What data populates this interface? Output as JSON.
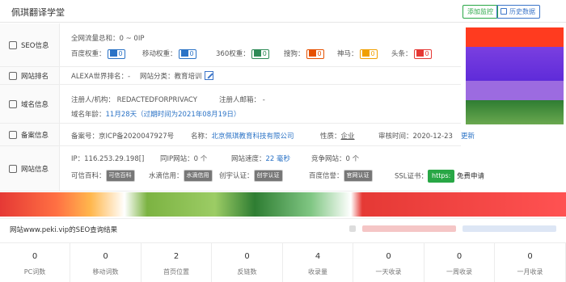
{
  "header": {
    "site_title": "佩琪翻译学堂",
    "add_monitor": "添加监控",
    "history": "历史数据"
  },
  "seo": {
    "label": "SEO信息",
    "traffic": "全网流量总和：0 ~ 0IP",
    "items": [
      {
        "name": "百度权重：",
        "value": "0",
        "color": "#2b73c6"
      },
      {
        "name": "移动权重：",
        "value": "0",
        "color": "#2b73c6"
      },
      {
        "name": "360权重：",
        "value": "0",
        "color": "#2e8b57"
      },
      {
        "name": "搜狗：",
        "value": "0",
        "color": "#e65100"
      },
      {
        "name": "神马：",
        "value": "0",
        "color": "#f0a000"
      },
      {
        "name": "头条：",
        "value": "0",
        "color": "#e53935"
      }
    ]
  },
  "rank": {
    "label": "网站排名",
    "alexa": "ALEXA世界排名：-",
    "category_label": "网站分类：",
    "category": "教育培训"
  },
  "domain": {
    "label": "域名信息",
    "registrant": "注册人/机构： REDACTEDFORPRIVACY",
    "email": "注册人邮箱： -",
    "age_label": "域名年龄：",
    "age": "11月28天（过期时间为2021年08月19日）"
  },
  "icp": {
    "label": "备案信息",
    "record": "备案号：京ICP备2020047927号",
    "name_label": "名称：",
    "name": "北京佩琪教育科技有限公司",
    "nature_label": "性质：",
    "nature": "企业",
    "review_label": "审核时间：",
    "review": "2020-12-23",
    "update": "更新"
  },
  "site": {
    "label": "网站信息",
    "ip": "IP：116.253.29.198[]",
    "same_ip": "同IP网站：0 个",
    "speed_label": "网站速度：",
    "speed": "22 毫秒",
    "competitors": "竞争网站：0 个",
    "credits": [
      {
        "name": "可信百科：",
        "badge": "可信百科"
      },
      {
        "name": "水滴信用：",
        "badge": "水滴信用"
      },
      {
        "name": "创宇认证：",
        "badge": "创宇认证"
      },
      {
        "name": "百度信誉：",
        "badge": "官网认证"
      }
    ],
    "ssl_label": "SSL证书：",
    "ssl_badge": "https:",
    "ssl_apply": "免费申请"
  },
  "seo_query": {
    "title": "网站www.peki.vip的SEO查询结果"
  },
  "stats": [
    {
      "value": "0",
      "label": "PC词数"
    },
    {
      "value": "0",
      "label": "移动词数"
    },
    {
      "value": "2",
      "label": "首页位置"
    },
    {
      "value": "0",
      "label": "反链数"
    },
    {
      "value": "4",
      "label": "收录量"
    },
    {
      "value": "0",
      "label": "一天收录"
    },
    {
      "value": "0",
      "label": "一周收录"
    },
    {
      "value": "0",
      "label": "一月收录"
    }
  ]
}
